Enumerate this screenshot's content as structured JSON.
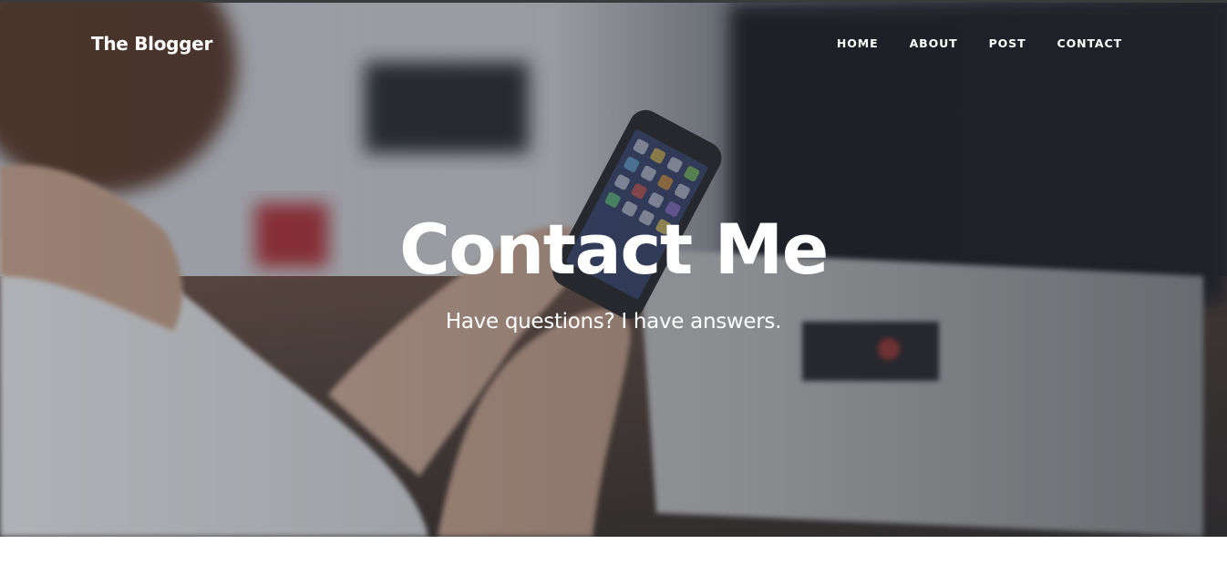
{
  "nav": {
    "brand": "The Blogger",
    "items": [
      {
        "label": "HOME"
      },
      {
        "label": "ABOUT"
      },
      {
        "label": "POST"
      },
      {
        "label": "CONTACT"
      }
    ]
  },
  "hero": {
    "heading": "Contact Me",
    "subheading": "Have questions? I have answers.",
    "background_image": "woman holding smartphone in living room"
  },
  "colors": {
    "text": "#ffffff",
    "overlay": "#212529",
    "page_background": "#ffffff"
  }
}
